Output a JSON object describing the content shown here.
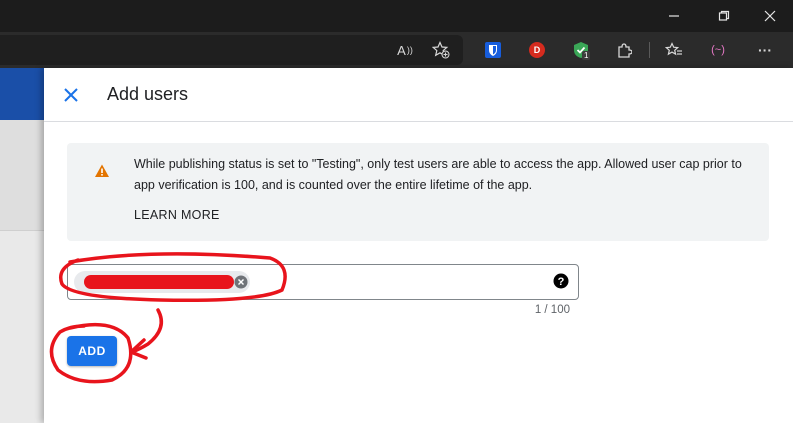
{
  "browser": {
    "read_aloud_label": "A",
    "extensions": [
      {
        "name": "bitwarden-icon"
      },
      {
        "name": "d-extension-icon",
        "label": "D"
      },
      {
        "name": "shield-extension-icon",
        "badge": "1"
      },
      {
        "name": "extensions-icon"
      },
      {
        "name": "favorites-icon"
      },
      {
        "name": "copilot-icon",
        "label": "(~)"
      }
    ],
    "more_label": "···"
  },
  "dialog": {
    "title": "Add users",
    "warning": {
      "text": "While publishing status is set to \"Testing\", only test users are able to access the app. Allowed user cap prior to app verification is 100, and is counted over the entire lifetime of the app.",
      "link": "LEARN MORE"
    },
    "user_input": {
      "chip_value": "redacted",
      "counter": "1 / 100"
    },
    "add_button": "ADD"
  },
  "colors": {
    "accent": "#1a73e8",
    "warning": "#e37400",
    "annotation": "#e8141c"
  }
}
